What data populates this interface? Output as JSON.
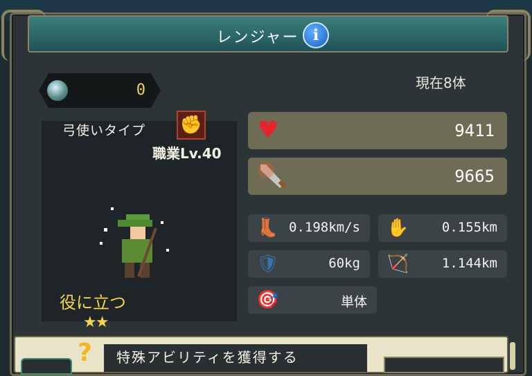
{
  "header": {
    "title": "レンジャー",
    "info_icon": "info-icon"
  },
  "currency": {
    "icon": "orb-icon",
    "value": "0"
  },
  "owned_count": "現在8体",
  "unit": {
    "type_label": "弓使いタイプ",
    "type_icon": "fist-icon",
    "job_level": "職業Lv.40",
    "rating": "役に立つ",
    "stars": "★★"
  },
  "stats": {
    "hp": {
      "icon": "heart-icon",
      "value": "9411"
    },
    "attack": {
      "icon": "sword-icon",
      "value": "9665"
    },
    "move_speed": {
      "icon": "boot-icon",
      "value": "0.198km/s"
    },
    "attack_range_melee": {
      "icon": "gauntlet-icon",
      "value": "0.155km"
    },
    "weight": {
      "icon": "armor-icon",
      "value": "60kg"
    },
    "attack_range": {
      "icon": "bow-icon",
      "value": "1.144km"
    },
    "target": {
      "icon": "target-icon",
      "value": "単体"
    }
  },
  "ability": {
    "icon": "question-icon",
    "text": "特殊アビリティを獲得する"
  },
  "colors": {
    "accent_gold": "#f3d64c",
    "stat_panel": "#6e6c55",
    "hp_red": "#e4262b"
  }
}
